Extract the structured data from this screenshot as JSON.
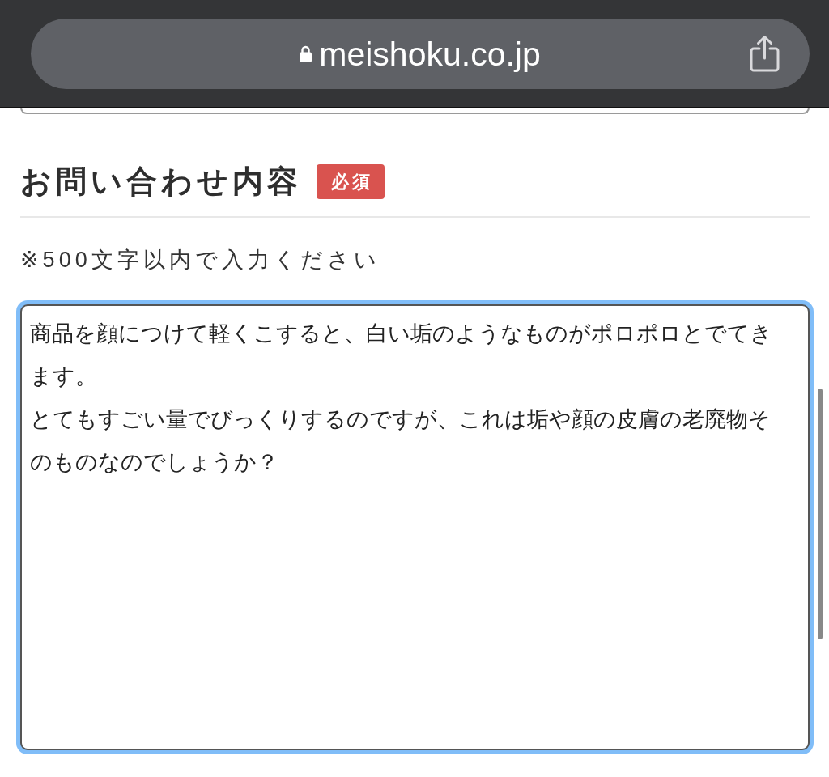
{
  "browser_bar": {
    "url": "meishoku.co.jp",
    "secure": true
  },
  "inquiry": {
    "label": "お問い合わせ内容",
    "badge": "必須",
    "note": "※500文字以内で入力ください",
    "message": {
      "paragraphs": [
        "商品を顔につけて軽くこすると、白い垢のようなものがポロポロとでてきます。",
        "とてもすごい量でびっくりするのですが、これは垢や顔の皮膚の老廃物そのものなのでしょうか？"
      ],
      "focused": true
    }
  }
}
